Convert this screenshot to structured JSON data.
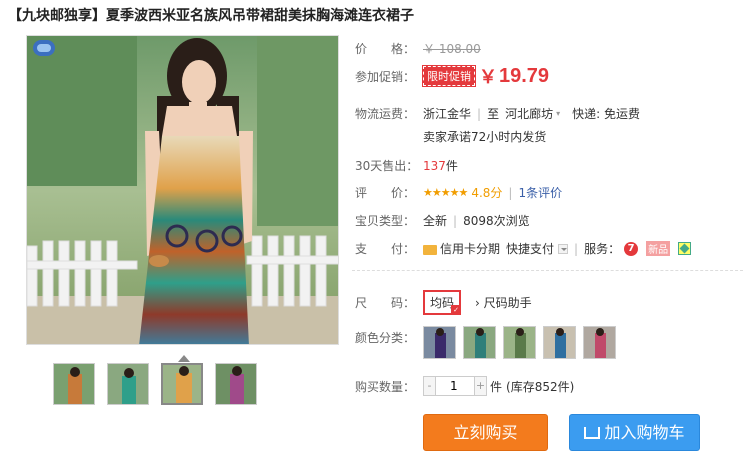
{
  "product": {
    "title": "【九块邮独享】夏季波西米亚名族风吊带裙甜美抹胸海滩连衣裙子"
  },
  "price": {
    "label": "价　　格：",
    "original": "￥ 108.00"
  },
  "promo": {
    "label": "参加促销：",
    "tag": "限时促销",
    "currency": "￥",
    "price": "19.79"
  },
  "shipping": {
    "label": "物流运费：",
    "from": "浙江金华",
    "to_sep": "至",
    "to": "河北廊坊",
    "fee": "快递: 免运费",
    "promise": "卖家承诺72小时内发货"
  },
  "sales": {
    "label": "30天售出：",
    "count": "137",
    "unit": "件"
  },
  "rating": {
    "label": "评　　价：",
    "stars": "★★★★★",
    "score": "4.8分",
    "reviews": "1条评价"
  },
  "type": {
    "label": "宝贝类型：",
    "condition": "全新",
    "views": "8098次浏览"
  },
  "payment": {
    "label": "支　　付：",
    "credit": "信用卡分期",
    "quick": "快捷支付",
    "service_label": "服务：",
    "service_7": "7",
    "service_new": "新品"
  },
  "size": {
    "label": "尺　　码：",
    "selected": "均码",
    "helper": "尺码助手"
  },
  "color": {
    "label": "颜色分类："
  },
  "quantity": {
    "label": "购买数量：",
    "minus": "-",
    "value": "1",
    "plus": "+",
    "unit": "件",
    "stock": "(库存852件)"
  },
  "actions": {
    "buy": "立刻购买",
    "cart": "加入购物车"
  }
}
